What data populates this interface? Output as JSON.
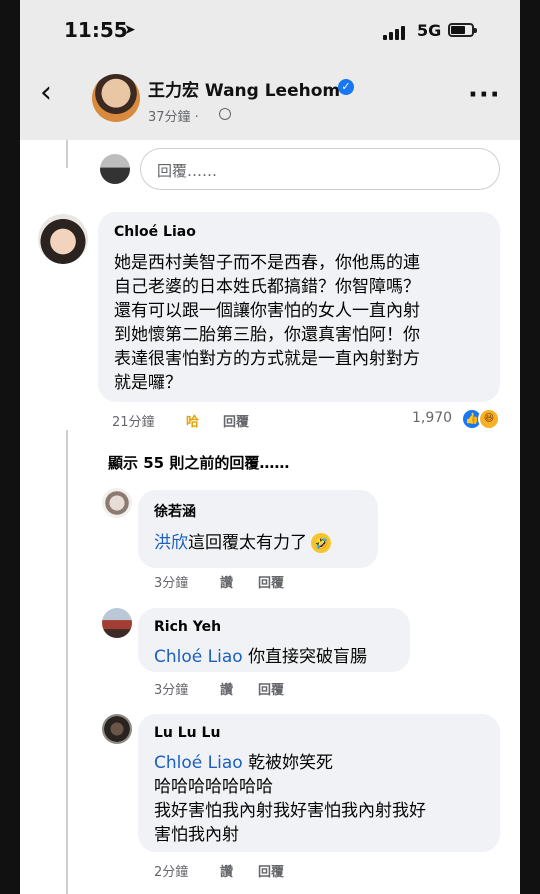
{
  "status_bar": {
    "time": "11:55",
    "network": "5G"
  },
  "post_header": {
    "author": "王力宏 Wang Leehom",
    "time_ago": "37分鐘 ·"
  },
  "reply_input": {
    "placeholder": "回覆……"
  },
  "main_comment": {
    "author": "Chloé Liao",
    "lines": [
      "她是西村美智子而不是西春，你他馬的連",
      "自己老婆的日本姓氏都搞錯？你智障嗎？",
      "還有可以跟一個讓你害怕的女人一直內射",
      "到她懷第二胎第三胎，你還真害怕阿！你",
      "表達很害怕對方的方式就是一直內射對方",
      "就是囉？"
    ],
    "time": "21分鐘",
    "reaction_label": "哈",
    "reply_label": "回覆",
    "reaction_count": "1,970",
    "reaction_icons": [
      "like-icon",
      "haha-icon"
    ]
  },
  "show_previous": "顯示 55 則之前的回覆……",
  "replies": [
    {
      "author": "徐若涵",
      "mention": "洪欣",
      "text": "這回覆太有力了",
      "emoji": "rolling-laugh-emoji",
      "time": "3分鐘",
      "like_label": "讚",
      "reply_label": "回覆"
    },
    {
      "author": "Rich Yeh",
      "mention": "Chloé Liao",
      "text": "你直接突破盲腸",
      "time": "3分鐘",
      "like_label": "讚",
      "reply_label": "回覆"
    },
    {
      "author": "Lu Lu Lu",
      "mention": "Chloé Liao",
      "text_first": "乾被妳笑死",
      "lines": [
        "哈哈哈哈哈哈哈",
        "我好害怕我內射我好害怕我內射我好",
        "害怕我內射"
      ],
      "time": "2分鐘",
      "like_label": "讚",
      "reply_label": "回覆"
    }
  ]
}
